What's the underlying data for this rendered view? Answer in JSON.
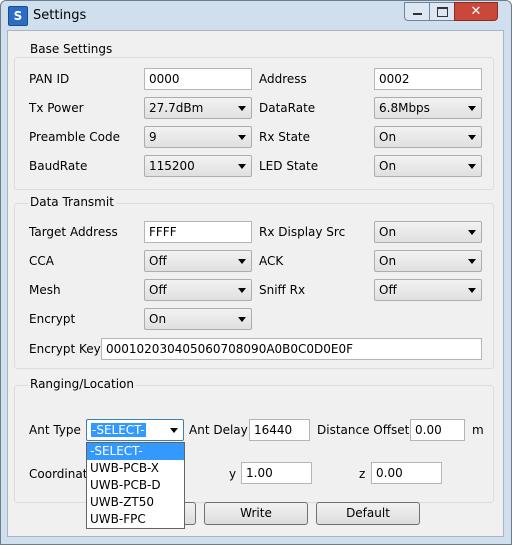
{
  "window": {
    "title": "Settings",
    "app_icon_letter": "S",
    "minimize_glyph": "",
    "maximize_glyph": "",
    "close_glyph": "✕"
  },
  "base": {
    "legend": "Base Settings",
    "pan_id_label": "PAN ID",
    "pan_id_value": "0000",
    "address_label": "Address",
    "address_value": "0002",
    "tx_power_label": "Tx Power",
    "tx_power_value": "27.7dBm",
    "datarate_label": "DataRate",
    "datarate_value": "6.8Mbps",
    "preamble_label": "Preamble Code",
    "preamble_value": "9",
    "rx_state_label": "Rx State",
    "rx_state_value": "On",
    "baudrate_label": "BaudRate",
    "baudrate_value": "115200",
    "led_state_label": "LED State",
    "led_state_value": "On"
  },
  "transmit": {
    "legend": "Data Transmit",
    "target_address_label": "Target Address",
    "target_address_value": "FFFF",
    "rx_display_label": "Rx Display Src",
    "rx_display_value": "On",
    "cca_label": "CCA",
    "cca_value": "Off",
    "ack_label": "ACK",
    "ack_value": "On",
    "mesh_label": "Mesh",
    "mesh_value": "Off",
    "sniff_rx_label": "Sniff Rx",
    "sniff_rx_value": "Off",
    "encrypt_label": "Encrypt",
    "encrypt_value": "On",
    "encrypt_key_label": "Encrypt Key",
    "encrypt_key_value": "000102030405060708090A0B0C0D0E0F"
  },
  "ranging": {
    "legend": "Ranging/Location",
    "ant_type_label": "Ant Type",
    "ant_type_value": "-SELECT-",
    "ant_delay_label": "Ant Delay",
    "ant_delay_value": "16440",
    "distance_offset_label": "Distance Offset",
    "distance_offset_value": "0.00",
    "distance_offset_unit": "m",
    "coordinate_label": "Coordinat",
    "y_label": "y",
    "y_value": "1.00",
    "z_label": "z",
    "z_value": "0.00"
  },
  "ant_type_options": [
    "-SELECT-",
    "UWB-PCB-X",
    "UWB-PCB-D",
    "UWB-ZT50",
    "UWB-FPC"
  ],
  "buttons": {
    "write_label": "Write",
    "default_label": "Default"
  },
  "colors": {
    "selection": "#3399ff",
    "close_button": "#c9483a",
    "frame": "#cfdfee"
  }
}
